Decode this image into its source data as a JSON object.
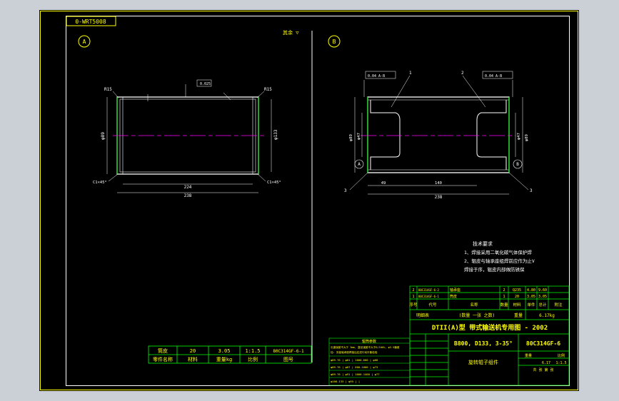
{
  "colors": {
    "background": "#cbd0d7",
    "sheet": "#000000",
    "frame": "#ffff00",
    "outline": "#ffffff",
    "text": "#ffff00",
    "green": "#00ff00",
    "centerline": "#ff00ff",
    "dimension": "#ffffff",
    "table_text": "#ffff00"
  },
  "sheet": {
    "stamp": "0-WRT5008",
    "view_a_label": "A",
    "view_b_label": "B",
    "view_a_note": "其余 ▽"
  },
  "view_a": {
    "callout_left": "R15",
    "callout_right": "R15",
    "top_tol": "0.025",
    "dim_inner": "224",
    "dim_overall": "238",
    "dim_left_dia": "φ89",
    "dim_right_dia": "φ133",
    "chamfer_left": "C1×45°",
    "chamfer_right": "C1×45°"
  },
  "view_b": {
    "tol_left": "0.04 A-B",
    "tol_right": "0.04 A-B",
    "part1": "1",
    "part2": "2",
    "dim_bottom_left": "49",
    "dim_bottom_mid": "140",
    "dim_overall": "238",
    "dim_left_1": "φ89",
    "dim_left_2": "φ47",
    "dim_right_1": "φ47",
    "dim_right_2": "φ89",
    "datum_a": "A",
    "datum_b": "B",
    "mark_3": "3",
    "mark_3b": "3"
  },
  "tech_req": {
    "title": "技术要求",
    "lines": [
      "1、焊接采用二氧化碳气体保护焊",
      "2、辊皮与轴承座组焊前应作为止V",
      "  焊接于序，辊皮内部做防锈保"
    ]
  },
  "small_table": {
    "row1": [
      "筒皮",
      "20",
      "3.05",
      "1:1.5",
      "80C314GF-6-1"
    ],
    "row2": [
      "零件名称",
      "材料",
      "重量kg",
      "比例",
      "图号"
    ]
  },
  "notes_table": {
    "title": "辊筒参数",
    "rows": [
      "长度误差不大于 3mm, 直径误差不大于D/100%, φ3.5偏差",
      "径: 安装轴承座焊接后应进行动平衡检验",
      "φ89-76 | φ81 | 1000-600 | φ68",
      "φ89-76 | φ87 | 600-1000 | φ73",
      "φ89-76 | φ91 | 1000-1400 | φ77",
      "φ108-133 | φ95 |  | "
    ]
  },
  "title_block": {
    "parts": [
      [
        "2",
        "80C314GF-6-2",
        "轴承座",
        "2",
        "Q235",
        "4.80",
        "9.60",
        ""
      ],
      [
        "1",
        "80C314GF-6-1",
        "筒皮",
        "1",
        "20",
        "3.05",
        "3.05",
        ""
      ]
    ],
    "header": [
      "序号",
      "代号",
      "名称",
      "数量",
      "材料",
      "单件",
      "总计",
      "附注"
    ],
    "weight_row": [
      "明细表",
      "(数量 一张 之数)",
      "重量",
      "6.17kg"
    ],
    "main_title": "DTII(A)型  带式输送机专用图 - 2002",
    "spec": "B800, D133, 3-35°",
    "drawing_no": "80C314GF-6",
    "part_name": "旋转辊子组件",
    "scale_label": "比例",
    "scale": "1:1.5",
    "weight_label": "重量",
    "weight": "6.17",
    "sheet_label": "共 张 第 张"
  }
}
